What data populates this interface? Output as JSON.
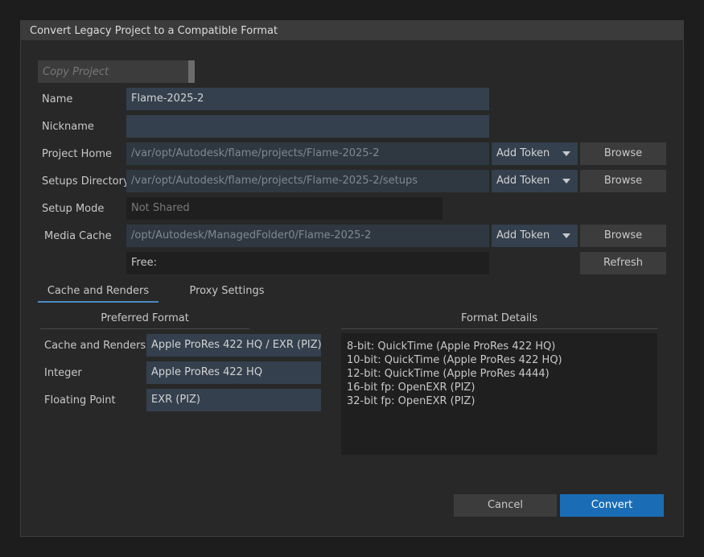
{
  "window": {
    "title": "Convert Legacy Project to a Compatible Format"
  },
  "copy_project": {
    "placeholder": "Copy Project"
  },
  "form": {
    "name": {
      "label": "Name",
      "value": "Flame-2025-2"
    },
    "nickname": {
      "label": "Nickname",
      "value": ""
    },
    "project_home": {
      "label": "Project Home",
      "value": "/var/opt/Autodesk/flame/projects/Flame-2025-2",
      "token": "Add Token",
      "browse": "Browse"
    },
    "setups_directory": {
      "label": "Setups Directory",
      "value": "/var/opt/Autodesk/flame/projects/Flame-2025-2/setups",
      "token": "Add Token",
      "browse": "Browse"
    },
    "setup_mode": {
      "label": "Setup Mode",
      "value": "Not Shared"
    },
    "media_cache": {
      "label": "Media Cache",
      "value": "/opt/Autodesk/ManagedFolder0/Flame-2025-2",
      "token": "Add Token",
      "browse": "Browse"
    },
    "free": {
      "label": "Free:",
      "refresh": "Refresh"
    }
  },
  "tabs": [
    {
      "label": "Cache and Renders",
      "active": true
    },
    {
      "label": "Proxy Settings",
      "active": false
    }
  ],
  "preferred_format": {
    "heading": "Preferred Format",
    "rows": [
      {
        "label": "Cache and Renders",
        "value": "Apple ProRes 422 HQ / EXR (PIZ)"
      },
      {
        "label": "Integer",
        "value": "Apple ProRes 422 HQ"
      },
      {
        "label": "Floating Point",
        "value": "EXR (PIZ)"
      }
    ]
  },
  "format_details": {
    "heading": "Format Details",
    "lines": [
      "8-bit: QuickTime (Apple ProRes 422 HQ)",
      "10-bit: QuickTime (Apple ProRes 422 HQ)",
      "12-bit: QuickTime (Apple ProRes 4444)",
      "16-bit fp: OpenEXR (PIZ)",
      "32-bit fp: OpenEXR (PIZ)"
    ]
  },
  "footer": {
    "cancel": "Cancel",
    "convert": "Convert"
  },
  "colors": {
    "accent": "#1a6db5",
    "tab_underline": "#4a8bc2",
    "background": "#282828",
    "field": "#34404d"
  }
}
